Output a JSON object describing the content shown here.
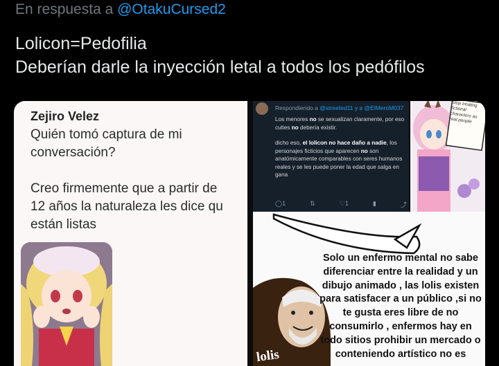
{
  "reply": {
    "prefix": "En respuesta a",
    "handle": "@OtakuCursed2"
  },
  "tweet": {
    "line1": "Lolicon=Pedofilia",
    "line2": "Deberían darle la inyección letal a todos los pedófilos"
  },
  "media": {
    "left_panel": {
      "author": "Zejiro Velez",
      "paragraph1": "Quién tomó captura de mi conversación?",
      "paragraph2": "Creo firmemente que a partir de\n12 años la naturaleza les dice qu\nestán listas"
    },
    "embedded_tweet": {
      "reply_prefix": "Respondiendo a",
      "reply_handles": "@streeted11 y a @ElMeroM037",
      "p1_pre": "Los menores ",
      "p1_bold1": "no",
      "p1_mid": " se sexualizan claramente, por eso cuties ",
      "p1_bold2": "no",
      "p1_post": " debería existir.",
      "p2_pre": "dicho eso, ",
      "p2_bold": "el lolicon no hace daño a nadie",
      "p2_mid": ", los personajes ficticios que aparecen ",
      "p2_bold2": "no",
      "p2_post": " son anatómicamente comparables con seres humanos reales y se les puede poner la edad que salga en gana",
      "reply_count": "1",
      "like_count": "1",
      "icons": [
        "reply-icon",
        "retweet-icon",
        "like-icon",
        "stats-icon",
        "share-icon"
      ]
    },
    "sign_text": "Stop treating fictional characters as real people",
    "meme_text": "Solo un enfermo mental no sabe diferenciar entre la realidad y un dibujo animado , las lolis existen para satisfacer a un público ,si no te gusta eres libre de no consumirlo , enfermos hay en todo sitios prohibir un mercado o conteniendo artístico no es",
    "meme_tag": "lolis"
  },
  "colors": {
    "background": "#000000",
    "text_primary": "#e7e9ea",
    "text_secondary": "#71767b",
    "link": "#1d9bf0"
  }
}
